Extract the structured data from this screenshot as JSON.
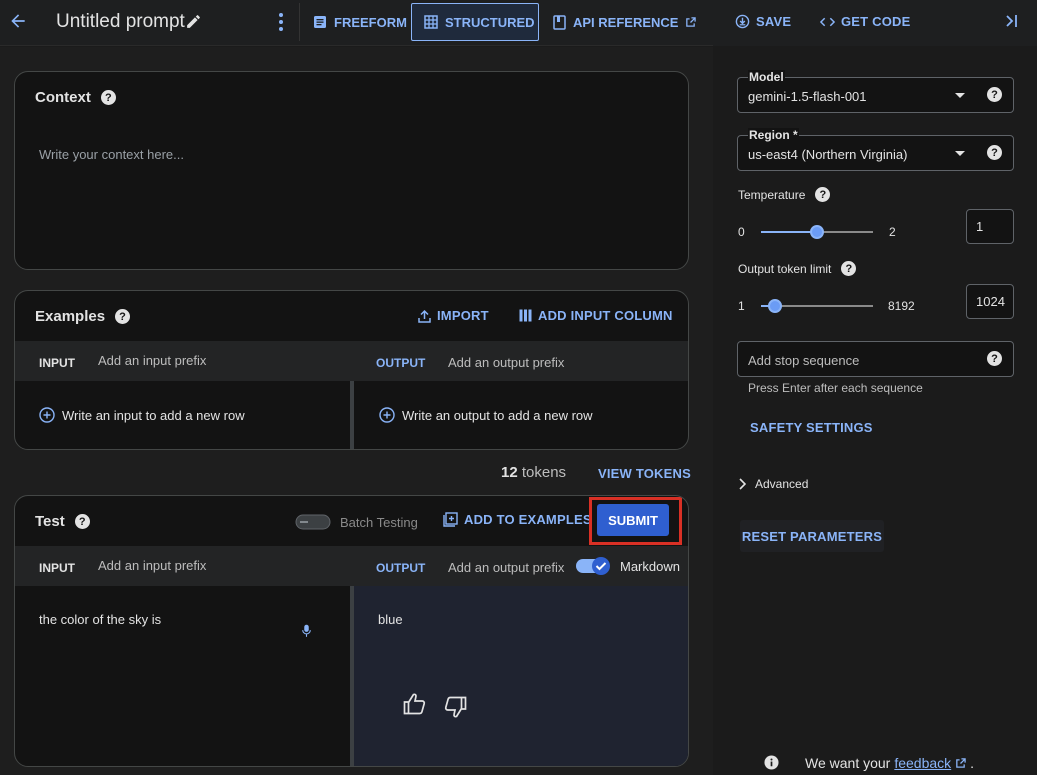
{
  "header": {
    "title": "Untitled prompt",
    "modes": [
      "FREEFORM",
      "STRUCTURED",
      "API REFERENCE"
    ],
    "save": "SAVE",
    "get_code": "GET CODE"
  },
  "context": {
    "title": "Context",
    "placeholder": "Write your context here..."
  },
  "examples": {
    "title": "Examples",
    "import": "IMPORT",
    "add_column": "ADD INPUT COLUMN",
    "input_label": "INPUT",
    "input_prefix": "Add an input prefix",
    "output_label": "OUTPUT",
    "output_prefix": "Add an output prefix",
    "input_add": "Write an input to add a new row",
    "output_add": "Write an output to add a new row"
  },
  "tokens": {
    "count": "12",
    "unit": "tokens",
    "view": "VIEW TOKENS"
  },
  "test": {
    "title": "Test",
    "batch": "Batch Testing",
    "add_to_examples": "ADD TO EXAMPLES",
    "submit": "SUBMIT",
    "input_label": "INPUT",
    "input_prefix": "Add an input prefix",
    "output_label": "OUTPUT",
    "output_prefix": "Add an output prefix",
    "markdown": "Markdown",
    "input_text": "the color of the sky is",
    "output_text": "blue"
  },
  "params": {
    "model_label": "Model",
    "model_value": "gemini-1.5-flash-001",
    "region_label": "Region *",
    "region_value": "us-east4 (Northern Virginia)",
    "temperature_label": "Temperature",
    "temp_min": "0",
    "temp_max": "2",
    "temp_value": "1",
    "temp_fraction": 0.5,
    "token_label": "Output token limit",
    "token_min": "1",
    "token_max": "8192",
    "token_value": "1024",
    "stop_placeholder": "Add stop sequence",
    "stop_hint": "Press Enter after each sequence",
    "safety": "SAFETY SETTINGS",
    "advanced": "Advanced",
    "reset": "RESET PARAMETERS"
  },
  "footer": {
    "text": "We want your",
    "link": "feedback",
    "period": "."
  },
  "colors": {
    "accent": "#8ab4f8",
    "submit_bg": "#2f5fd0",
    "highlight": "#d93025"
  }
}
